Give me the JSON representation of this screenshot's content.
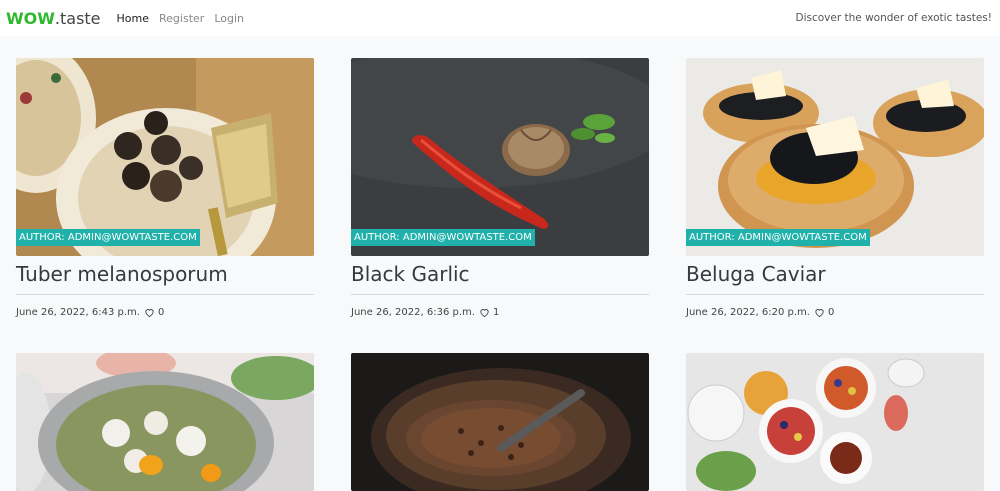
{
  "navbar": {
    "brand_bold": "WOW",
    "brand_rest": ".taste",
    "links": [
      "Home",
      "Register",
      "Login"
    ],
    "tagline": "Discover the wonder of exotic tastes!"
  },
  "colors": {
    "brand_green": "#2eb82e",
    "author_badge": "#20b2aa",
    "background": "#f8f9fa"
  },
  "cards": [
    {
      "author": "AUTHOR: ADMIN@WOWTASTE.COM",
      "title": "Tuber melanosporum",
      "date": "June 26, 2022, 6:43 p.m.",
      "likes": "0",
      "icon": "heart-icon"
    },
    {
      "author": "AUTHOR: ADMIN@WOWTASTE.COM",
      "title": "Black Garlic",
      "date": "June 26, 2022, 6:36 p.m.",
      "likes": "1",
      "icon": "heart-icon"
    },
    {
      "author": "AUTHOR: ADMIN@WOWTASTE.COM",
      "title": "Beluga Caviar",
      "date": "June 26, 2022, 6:20 p.m.",
      "likes": "0",
      "icon": "heart-icon"
    },
    {
      "photo": "seafood-rice-bowl"
    },
    {
      "photo": "coffee-beans-roasting-pan"
    },
    {
      "photo": "breakfast-table-spread"
    }
  ]
}
